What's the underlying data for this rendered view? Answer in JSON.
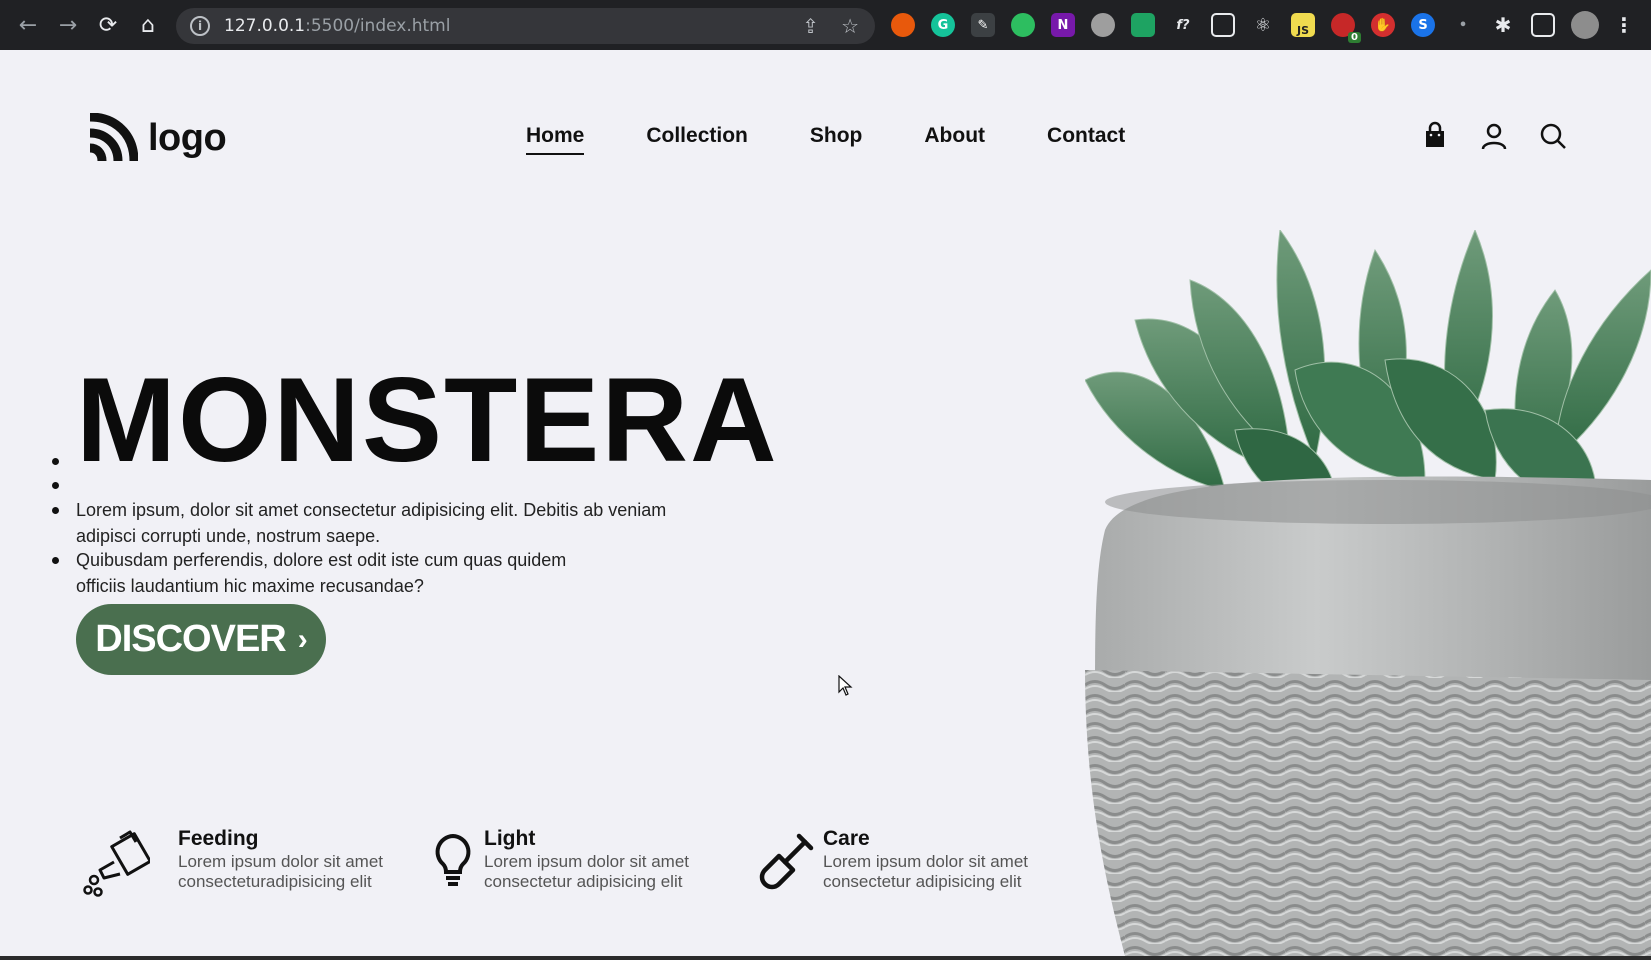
{
  "browser": {
    "url_host": "127.0.0.1",
    "url_path": ":5500/index.html",
    "extension_badge": "0",
    "extension_js_label": "JS",
    "extension_f_label": "f?"
  },
  "header": {
    "logo_text": "logo",
    "nav": [
      "Home",
      "Collection",
      "Shop",
      "About",
      "Contact"
    ],
    "icons": [
      "shopping-bag-icon",
      "user-icon",
      "search-icon"
    ]
  },
  "hero": {
    "title": "MONSTERA",
    "paragraphs": [
      "Lorem ipsum, dolor sit amet consectetur adipisicing elit. Debitis ab veniam adipisci corrupti unde, nostrum saepe.",
      "Quibusdam perferendis, dolore est odit iste cum quas quidem officiis laudantium hic maxime recusandae?"
    ],
    "button_label": "DISCOVER",
    "button_color": "#4a6f4f"
  },
  "features": [
    {
      "icon": "watering-can-icon",
      "title": "Feeding",
      "text": "Lorem ipsum dolor sit amet consecteturadipisicing elit"
    },
    {
      "icon": "light-bulb-icon",
      "title": "Light",
      "text": "Lorem ipsum dolor sit amet consectetur adipisicing elit"
    },
    {
      "icon": "shovel-icon",
      "title": "Care",
      "text": "Lorem ipsum dolor sit amet consectetur adipisicing elit"
    }
  ]
}
